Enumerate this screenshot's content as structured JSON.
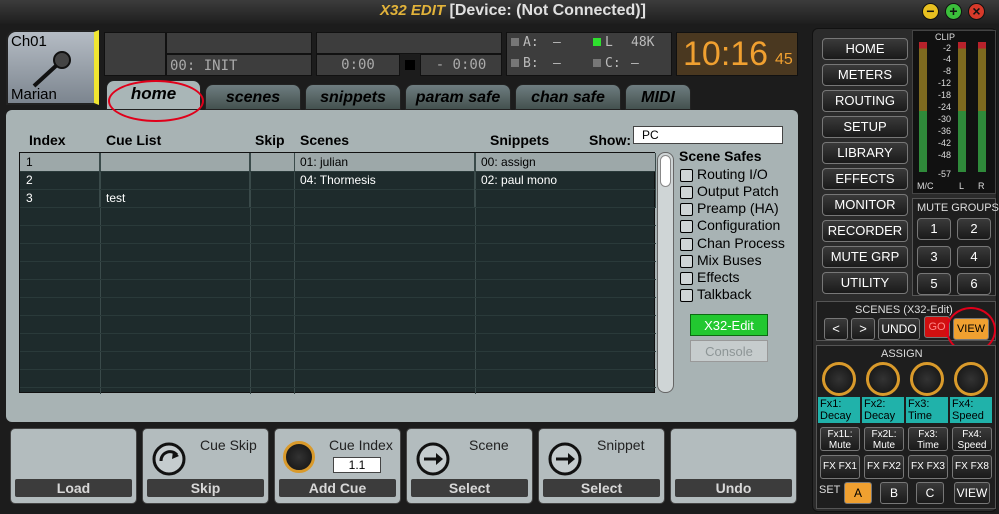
{
  "app": {
    "title": "[Device: (Not Connected)]",
    "logo": "X32 EDIT"
  },
  "window_controls": {
    "minimize": "−",
    "maximize": "+",
    "close": "×"
  },
  "channel": {
    "id": "Ch01",
    "name": "Marian"
  },
  "top_lcds": {
    "scene_display": "00: INIT",
    "time_left": "0:00",
    "time_right": "- 0:00"
  },
  "io_status": {
    "a_label": "A:",
    "a_value": "–",
    "b_label": "B:",
    "b_value": "–",
    "l_label": "L",
    "l_value": "48K",
    "c_label": "C:",
    "c_value": "–"
  },
  "clock": {
    "hm": "10:16",
    "sec": "45"
  },
  "tabs": [
    "home",
    "scenes",
    "snippets",
    "param safe",
    "chan safe",
    "MIDI"
  ],
  "cue_table": {
    "headers": {
      "index": "Index",
      "cue_list": "Cue List",
      "skip": "Skip",
      "scenes": "Scenes",
      "snippets": "Snippets"
    },
    "rows": [
      {
        "index": "1",
        "cue": "",
        "skip": "",
        "scene": "01: julian",
        "snippet": "00: assign"
      },
      {
        "index": "2",
        "cue": "",
        "skip": "",
        "scene": "04: Thormesis",
        "snippet": "02: paul mono"
      },
      {
        "index": "3",
        "cue": "test",
        "skip": "",
        "scene": "",
        "snippet": ""
      }
    ]
  },
  "show": {
    "label": "Show:",
    "value": "PC"
  },
  "scene_safes": {
    "title": "Scene Safes",
    "items": [
      "Routing I/O",
      "Output Patch",
      "Preamp (HA)",
      "Configuration",
      "Chan Process",
      "Mix Buses",
      "Effects",
      "Talkback"
    ]
  },
  "buttons": {
    "x32_edit": "X32-Edit",
    "console": "Console"
  },
  "bottom_controls": [
    {
      "title": "",
      "label": "Load"
    },
    {
      "title": "Cue Skip",
      "label": "Skip"
    },
    {
      "title": "Cue Index",
      "value": "1.1",
      "label": "Add Cue"
    },
    {
      "title": "Scene",
      "label": "Select"
    },
    {
      "title": "Snippet",
      "label": "Select"
    },
    {
      "title": "",
      "label": "Undo"
    }
  ],
  "nav": [
    "HOME",
    "METERS",
    "ROUTING",
    "SETUP",
    "LIBRARY",
    "EFFECTS",
    "MONITOR",
    "RECORDER",
    "MUTE GRP",
    "UTILITY"
  ],
  "meters": {
    "clip": "CLIP",
    "scale": [
      "-2",
      "-4",
      "-8",
      "-12",
      "-18",
      "-24",
      "-30",
      "-36",
      "-42",
      "-48",
      "-57"
    ],
    "labels": [
      "M/C",
      "L",
      "R"
    ]
  },
  "mute_groups": {
    "title": "MUTE GROUPS",
    "buttons": [
      "1",
      "2",
      "3",
      "4",
      "5",
      "6"
    ]
  },
  "scenes_x32": {
    "title": "SCENES (X32-Edit)",
    "prev": "<",
    "next": ">",
    "undo": "UNDO",
    "go": "GO",
    "view": "VIEW"
  },
  "assign": {
    "title": "ASSIGN",
    "knob_labels": [
      {
        "l1": "Fx1:",
        "l2": "Decay"
      },
      {
        "l1": "Fx2:",
        "l2": "Decay"
      },
      {
        "l1": "Fx3:",
        "l2": "Time"
      },
      {
        "l1": "Fx4:",
        "l2": "Speed"
      }
    ],
    "buttons_row1": [
      {
        "l1": "Fx1L:",
        "l2": "Mute"
      },
      {
        "l1": "Fx2L:",
        "l2": "Mute"
      },
      {
        "l1": "Fx3:",
        "l2": "Time"
      },
      {
        "l1": "Fx4:",
        "l2": "Speed"
      }
    ],
    "buttons_row2": [
      "FX FX1",
      "FX FX2",
      "FX FX3",
      "FX FX8"
    ],
    "set_label": "SET",
    "set_buttons": [
      "A",
      "B",
      "C"
    ],
    "view": "VIEW"
  },
  "colors": {
    "accent_orange": "#f0a030",
    "go_red": "#d01010",
    "x32_green": "#22c830",
    "annotation_red": "#e0001a"
  }
}
